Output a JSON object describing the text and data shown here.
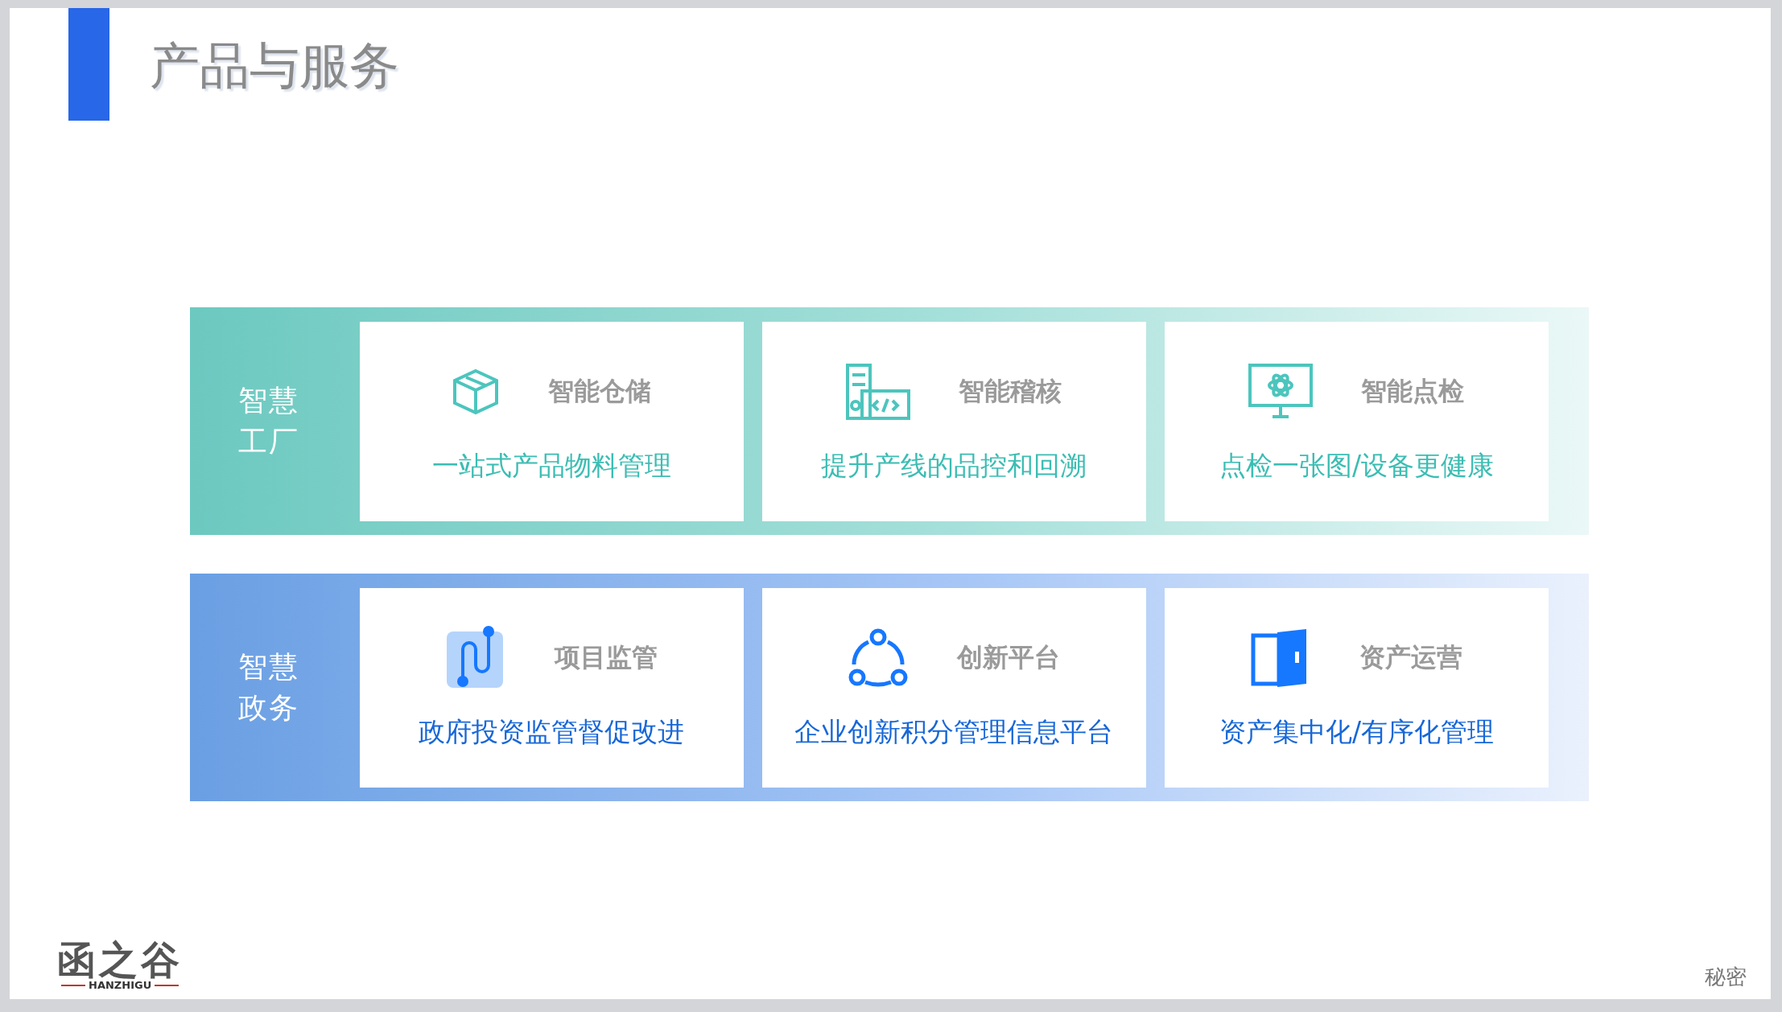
{
  "title": "产品与服务",
  "sections": [
    {
      "kind": "teal",
      "label": "智慧工厂",
      "cards": [
        {
          "title": "智能仓储",
          "subtitle": "一站式产品物料管理"
        },
        {
          "title": "智能稽核",
          "subtitle": "提升产线的品控和回溯"
        },
        {
          "title": "智能点检",
          "subtitle": "点检一张图/设备更健康"
        }
      ]
    },
    {
      "kind": "blue",
      "label": "智慧政务",
      "cards": [
        {
          "title": "项目监管",
          "subtitle": "政府投资监管督促改进"
        },
        {
          "title": "创新平台",
          "subtitle": "企业创新积分管理信息平台"
        },
        {
          "title": "资产运营",
          "subtitle": "资产集中化/有序化管理"
        }
      ]
    }
  ],
  "logo": {
    "name": "函之谷",
    "latin": "HANZHIGU"
  },
  "footer": "秘密"
}
